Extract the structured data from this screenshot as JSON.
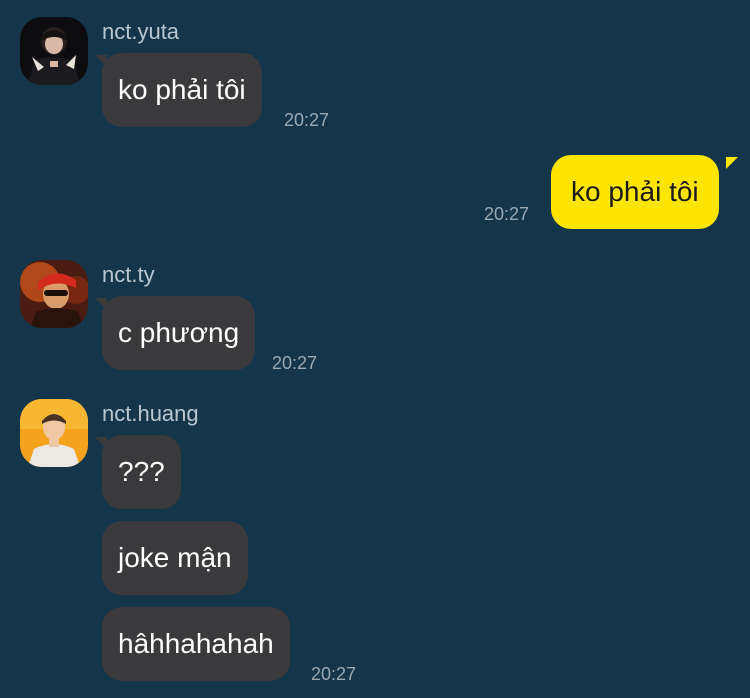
{
  "messages": {
    "m1": {
      "sender": "nct.yuta",
      "text": "ko phải tôi",
      "time": "20:27"
    },
    "m2": {
      "text": "ko phải tôi",
      "time": "20:27"
    },
    "m3": {
      "sender": "nct.ty",
      "text": "c phương",
      "time": "20:27"
    },
    "m4": {
      "sender": "nct.huang",
      "texts": [
        "???",
        "joke mận",
        "hâhhahahah"
      ],
      "time": "20:27"
    }
  },
  "colors": {
    "background": "#15364a",
    "incoming_bubble": "#3a3a3c",
    "outgoing_bubble": "#fee500",
    "timestamp": "#9aa8b2"
  },
  "icons": [
    "avatar-yuta",
    "avatar-ty",
    "avatar-huang"
  ]
}
